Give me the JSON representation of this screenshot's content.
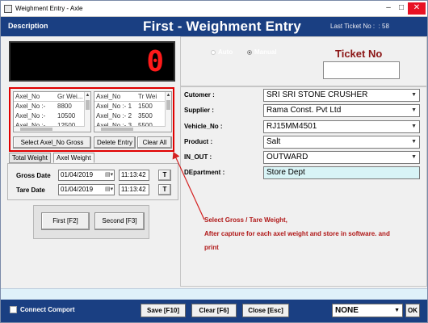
{
  "window": {
    "title": "Weighment Entry - Axle"
  },
  "header": {
    "description": "Description",
    "title": "First - Weighment Entry",
    "last_ticket_label": "Last Ticket No :",
    "last_ticket_value": "58"
  },
  "display": {
    "value": "0"
  },
  "gross_list": {
    "headers": [
      "Axel_No",
      "Gr Wei..."
    ],
    "rows": [
      [
        "Axel_No :-",
        "8800"
      ],
      [
        "Axel_No :-",
        "10500"
      ],
      [
        "Axel_No :-",
        "12500"
      ]
    ]
  },
  "tare_list": {
    "headers": [
      "Axel_No",
      "Tr Wei"
    ],
    "rows": [
      [
        "Axel_No :- 1",
        "1500"
      ],
      [
        "Axel_No :- 2",
        "3500"
      ],
      [
        "Axel_No :- 3",
        "5500"
      ]
    ]
  },
  "axel_buttons": {
    "select_gross": "Select Axel_No Gross",
    "delete_entry": "Delete Entry",
    "clear_all": "Clear All"
  },
  "tabs": {
    "total": "Total Weight",
    "axel": "Axel Weight"
  },
  "gross_date": {
    "label": "Gross Date",
    "date": "01/04/2019",
    "time": "11:13:42",
    "t_button": "T"
  },
  "tare_date": {
    "label": "Tare Date",
    "date": "01/04/2019",
    "time": "11:13:42",
    "t_button": "T"
  },
  "weigh_buttons": {
    "first": "First [F2]",
    "second": "Second [F3]"
  },
  "mode": {
    "auto": "Auto",
    "manual": "Manual",
    "selected": "Manual"
  },
  "ticket": {
    "label": "Ticket No",
    "value": ""
  },
  "form": {
    "customer": {
      "label": "Cutomer :",
      "value": "SRI SRI STONE CRUSHER"
    },
    "supplier": {
      "label": "Supplier :",
      "value": "Rama Const. Pvt Ltd"
    },
    "vehicle": {
      "label": "Vehicle_No :",
      "value": "RJ15MM4501"
    },
    "product": {
      "label": "Product :",
      "value": "Salt"
    },
    "in_out": {
      "label": "IN_OUT :",
      "value": "OUTWARD"
    },
    "department": {
      "label": "DEpartment :",
      "value": "Store Dept"
    }
  },
  "annotation": {
    "line1": "Select Gross / Tare Weight,",
    "line2": "After capture for each axel weight and store in software. and",
    "line3": "print"
  },
  "footer": {
    "connect_label": "Connect Comport",
    "save": "Save [F10]",
    "clear": "Clear [F6]",
    "close": "Close [Esc]",
    "port_value": "NONE",
    "ok": "OK"
  },
  "colors": {
    "header_bg": "#1a3f82",
    "highlight_border": "#e00000",
    "annotation": "#b01818",
    "ticket_label": "#8b1515",
    "display_digit": "#ff1a1a"
  }
}
